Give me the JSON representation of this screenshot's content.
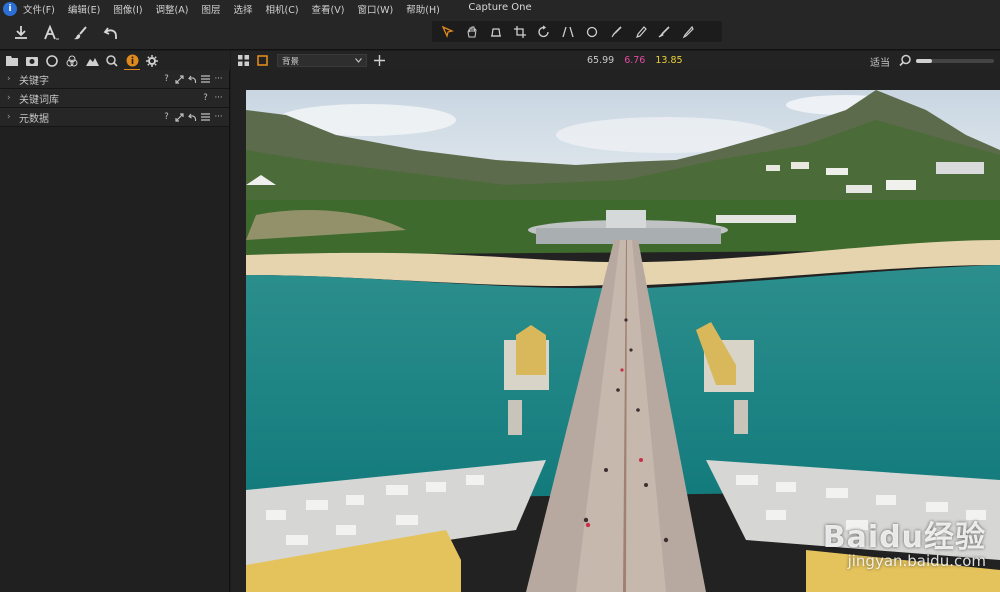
{
  "window": {
    "title": "Capture One"
  },
  "menu": [
    {
      "id": "file",
      "label": "文件(F)"
    },
    {
      "id": "edit",
      "label": "编辑(E)"
    },
    {
      "id": "image",
      "label": "图像(I)"
    },
    {
      "id": "adjust",
      "label": "调整(A)"
    },
    {
      "id": "layers",
      "label": "图层"
    },
    {
      "id": "select",
      "label": "选择"
    },
    {
      "id": "camera",
      "label": "相机(C)"
    },
    {
      "id": "view",
      "label": "查看(V)"
    },
    {
      "id": "window",
      "label": "窗口(W)"
    },
    {
      "id": "help",
      "label": "帮助(H)"
    }
  ],
  "toolbar": {
    "left_icons": [
      "import-icon",
      "text-tool-icon",
      "brush-icon",
      "undo-icon"
    ],
    "center_icons": [
      "select-cursor-icon",
      "pan-hand-icon",
      "loupe-icon",
      "crop-icon",
      "rotate-icon",
      "keystone-icon",
      "spot-removal-icon",
      "draw-mask-icon",
      "erase-mask-icon",
      "color-picker-icon",
      "annotate-icon"
    ],
    "accent_color": "#e08a1e"
  },
  "left_tabs": [
    "library-tab",
    "capture-tab",
    "lens-tab",
    "color-tab",
    "exposure-tab",
    "details-tab",
    "metadata-tab",
    "adjustments-tab"
  ],
  "tools": [
    {
      "id": "keywords",
      "label": "关键字",
      "actions": [
        "?",
        "link",
        "reset",
        "menu",
        "more"
      ]
    },
    {
      "id": "keyword-library",
      "label": "关键词库",
      "actions": [
        "?",
        "more"
      ]
    },
    {
      "id": "metadata",
      "label": "元数据",
      "actions": [
        "?",
        "link",
        "reset",
        "menu",
        "more"
      ]
    }
  ],
  "viewer": {
    "layer_select": "背景",
    "rgb": {
      "r": "65.99",
      "g": "6.76",
      "b": "13.85"
    },
    "fit_label": "适当",
    "zoom_fraction": 0.2
  },
  "watermark": {
    "main": "Baidu经验",
    "sub": "jingyan.baidu.com"
  }
}
